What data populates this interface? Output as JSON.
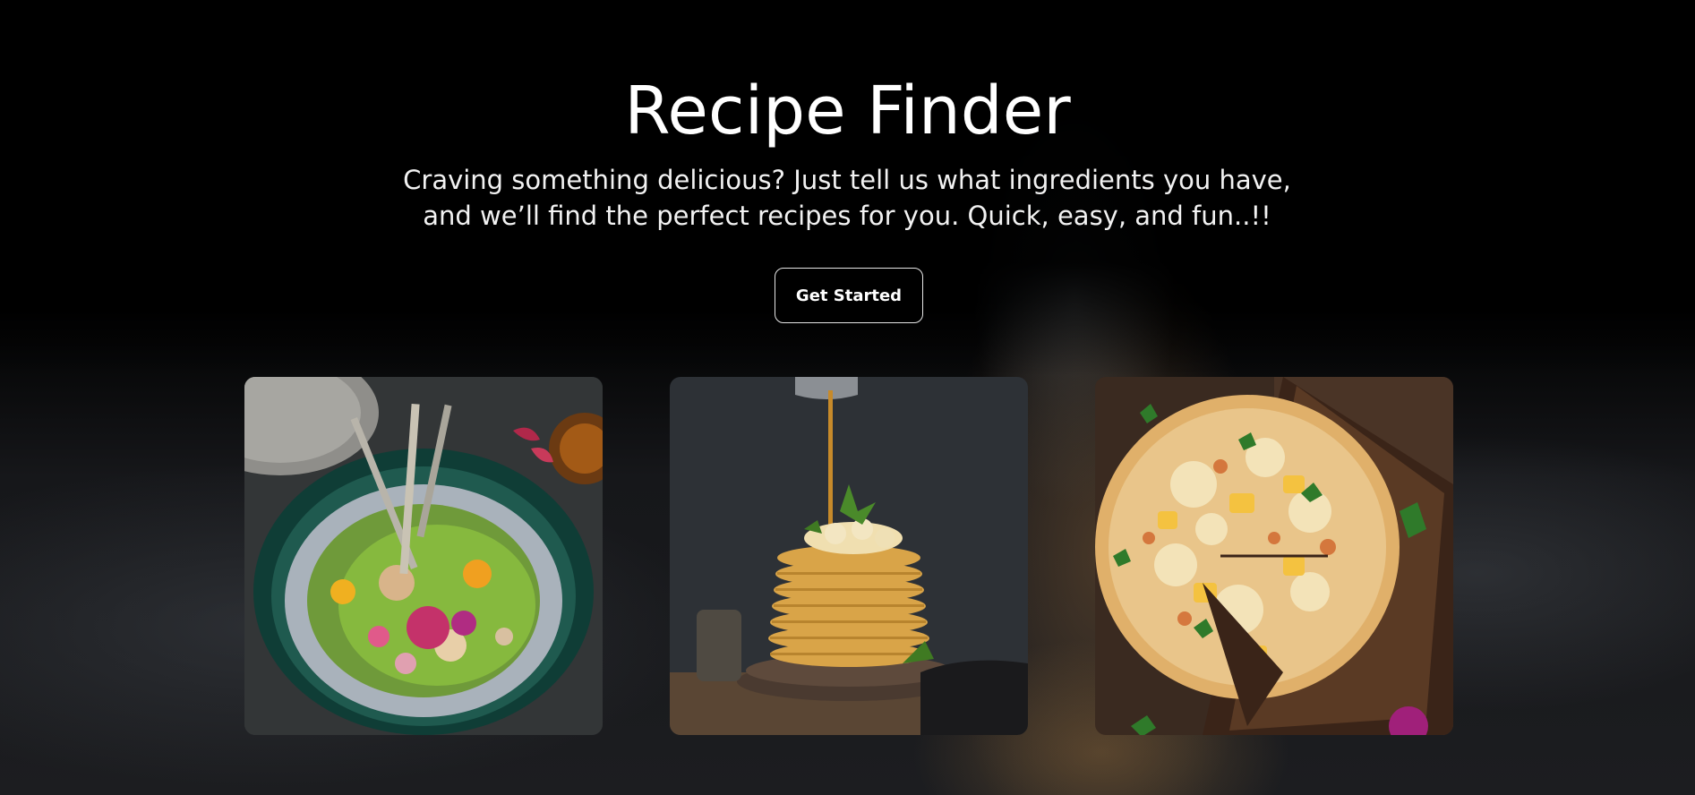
{
  "hero": {
    "title": "Recipe Finder",
    "subtitle": "Craving something delicious? Just tell us what ingredients you have, and we’ll find the perfect recipes for you. Quick, easy, and fun..!!",
    "cta_label": "Get Started"
  },
  "gallery": {
    "images": [
      {
        "subject": "salad-bowl-image"
      },
      {
        "subject": "pancake-stack-image"
      },
      {
        "subject": "pizza-image"
      }
    ]
  },
  "colors": {
    "background": "#000000",
    "text": "#ffffff",
    "button_border": "#e6e6e6"
  }
}
